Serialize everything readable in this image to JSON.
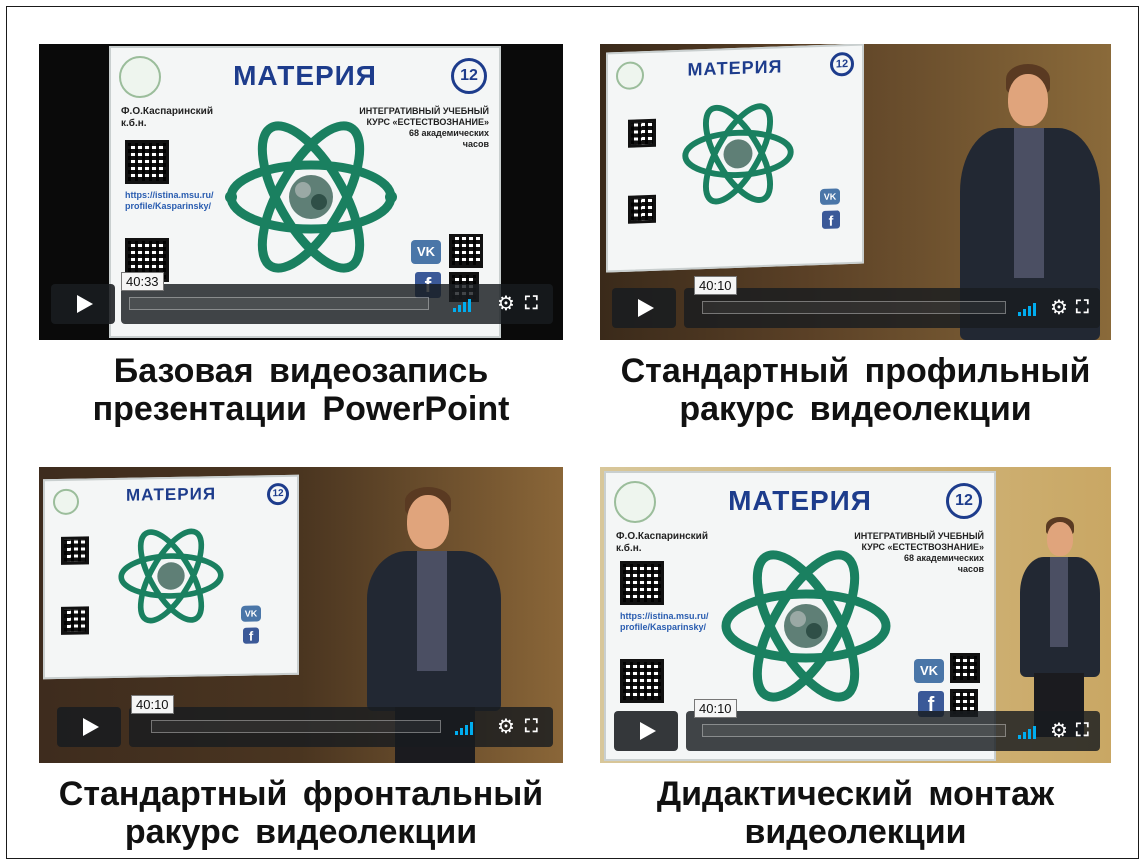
{
  "slide": {
    "title": "МАТЕРИЯ",
    "number": "12",
    "author_line1": "Ф.О.Каспаринский",
    "author_line2": "к.б.н.",
    "course_line1": "ИНТЕГРАТИВНЫЙ УЧЕБНЫЙ",
    "course_line2": "КУРС «ЕСТЕСТВОЗНАНИЕ»",
    "course_line3": "68 академических",
    "course_line4": "часов",
    "link1": "https://istina.msu.ru/",
    "link2": "profile/Kasparinsky/",
    "vk_label": "VK",
    "fb_label": "f"
  },
  "videos": [
    {
      "caption_line1": "Базовая видеозапись",
      "caption_line2": "презентации PowerPoint",
      "time": "40:33"
    },
    {
      "caption_line1": "Стандартный профильный",
      "caption_line2": "ракурс видеолекции",
      "time": "40:10"
    },
    {
      "caption_line1": "Стандартный фронтальный",
      "caption_line2": "ракурс видеолекции",
      "time": "40:10"
    },
    {
      "caption_line1": "Дидактический монтаж",
      "caption_line2": "видеолекции",
      "time": "40:10"
    }
  ],
  "icons": {
    "play": "play-icon",
    "volume": "volume-icon",
    "settings": "gear-icon",
    "fullscreen": "fullscreen-icon"
  },
  "colors": {
    "accent": "#00adef",
    "slide_title": "#1d3c8c",
    "atom": "#1a8060"
  }
}
